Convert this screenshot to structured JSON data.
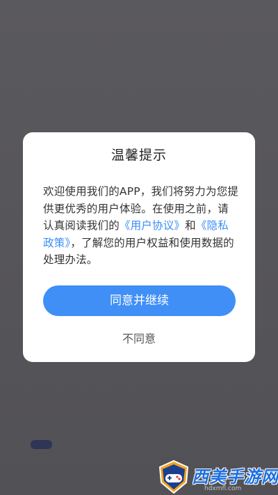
{
  "dialog": {
    "title": "温馨提示",
    "body_part1": "欢迎使用我们的APP，我们将努力为您提供更优秀的用户体验。在使用之前，请认真阅读我们的",
    "user_agreement_link": "《用户协议》",
    "body_and": "和",
    "privacy_policy_link": "《隐私政策》",
    "body_part2": "，了解您的用户权益和使用数据的处理办法。",
    "agree_label": "同意并继续",
    "disagree_label": "不同意"
  },
  "watermark": {
    "text": "西美手游网",
    "sub": "hdxmfl.com"
  },
  "colors": {
    "overlay": "#545357",
    "accent": "#3f8ff6",
    "link": "#3a8ef6"
  }
}
